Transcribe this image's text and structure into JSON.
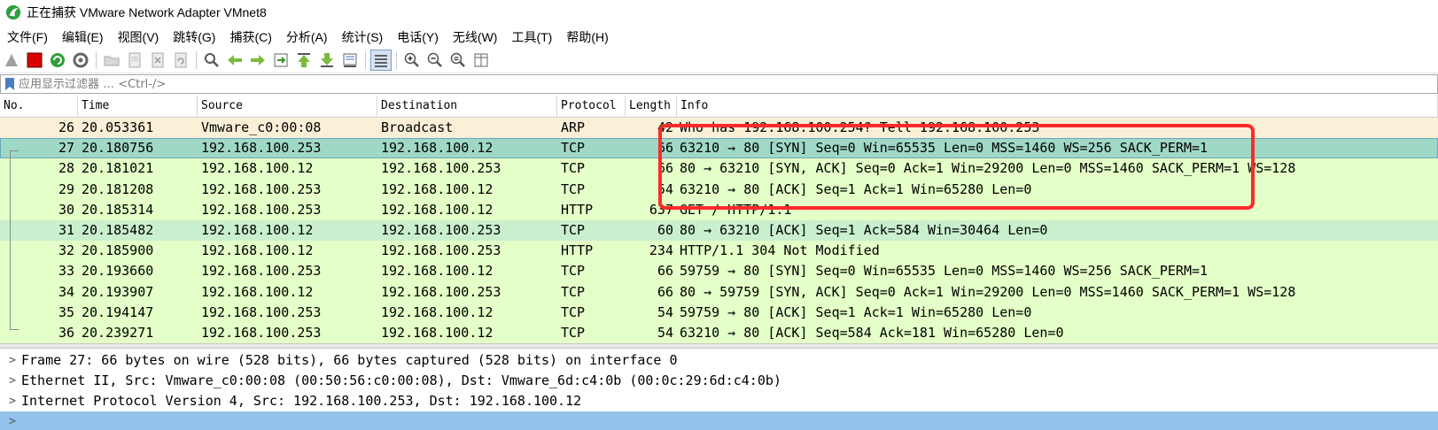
{
  "window": {
    "title": "正在捕获 VMware Network Adapter VMnet8"
  },
  "menu": [
    {
      "label": "文件(F)"
    },
    {
      "label": "编辑(E)"
    },
    {
      "label": "视图(V)"
    },
    {
      "label": "跳转(G)"
    },
    {
      "label": "捕获(C)"
    },
    {
      "label": "分析(A)"
    },
    {
      "label": "统计(S)"
    },
    {
      "label": "电话(Y)"
    },
    {
      "label": "无线(W)"
    },
    {
      "label": "工具(T)"
    },
    {
      "label": "帮助(H)"
    }
  ],
  "filter": {
    "placeholder": "应用显示过滤器 … <Ctrl-/>",
    "value": ""
  },
  "columns": {
    "no": "No.",
    "time": "Time",
    "source": "Source",
    "destination": "Destination",
    "protocol": "Protocol",
    "length": "Length",
    "info": "Info"
  },
  "rows": [
    {
      "no": "26",
      "time": "20.053361",
      "src": "Vmware_c0:00:08",
      "dst": "Broadcast",
      "proto": "ARP",
      "len": "42",
      "info": "Who has 192.168.100.254? Tell 192.168.100.253",
      "bg": "#faf0d7"
    },
    {
      "no": "27",
      "time": "20.180756",
      "src": "192.168.100.253",
      "dst": "192.168.100.12",
      "proto": "TCP",
      "len": "66",
      "info": "63210 → 80 [SYN] Seq=0 Win=65535 Len=0 MSS=1460 WS=256 SACK_PERM=1",
      "bg": "#a0d8c8",
      "selected": true
    },
    {
      "no": "28",
      "time": "20.181021",
      "src": "192.168.100.12",
      "dst": "192.168.100.253",
      "proto": "TCP",
      "len": "66",
      "info": "80 → 63210 [SYN, ACK] Seq=0 Ack=1 Win=29200 Len=0 MSS=1460 SACK_PERM=1 WS=128",
      "bg": "#e4ffc7"
    },
    {
      "no": "29",
      "time": "20.181208",
      "src": "192.168.100.253",
      "dst": "192.168.100.12",
      "proto": "TCP",
      "len": "54",
      "info": "63210 → 80 [ACK] Seq=1 Ack=1 Win=65280 Len=0",
      "bg": "#e4ffc7"
    },
    {
      "no": "30",
      "time": "20.185314",
      "src": "192.168.100.253",
      "dst": "192.168.100.12",
      "proto": "HTTP",
      "len": "637",
      "info": "GET / HTTP/1.1",
      "bg": "#e4ffc7"
    },
    {
      "no": "31",
      "time": "20.185482",
      "src": "192.168.100.12",
      "dst": "192.168.100.253",
      "proto": "TCP",
      "len": "60",
      "info": "80 → 63210 [ACK] Seq=1 Ack=584 Win=30464 Len=0",
      "bg": "#c9efcf"
    },
    {
      "no": "32",
      "time": "20.185900",
      "src": "192.168.100.12",
      "dst": "192.168.100.253",
      "proto": "HTTP",
      "len": "234",
      "info": "HTTP/1.1 304 Not Modified",
      "bg": "#e4ffc7"
    },
    {
      "no": "33",
      "time": "20.193660",
      "src": "192.168.100.253",
      "dst": "192.168.100.12",
      "proto": "TCP",
      "len": "66",
      "info": "59759 → 80 [SYN] Seq=0 Win=65535 Len=0 MSS=1460 WS=256 SACK_PERM=1",
      "bg": "#e4ffc7"
    },
    {
      "no": "34",
      "time": "20.193907",
      "src": "192.168.100.12",
      "dst": "192.168.100.253",
      "proto": "TCP",
      "len": "66",
      "info": "80 → 59759 [SYN, ACK] Seq=0 Ack=1 Win=29200 Len=0 MSS=1460 SACK_PERM=1 WS=128",
      "bg": "#e4ffc7"
    },
    {
      "no": "35",
      "time": "20.194147",
      "src": "192.168.100.253",
      "dst": "192.168.100.12",
      "proto": "TCP",
      "len": "54",
      "info": "59759 → 80 [ACK] Seq=1 Ack=1 Win=65280 Len=0",
      "bg": "#e4ffc7"
    },
    {
      "no": "36",
      "time": "20.239271",
      "src": "192.168.100.253",
      "dst": "192.168.100.12",
      "proto": "TCP",
      "len": "54",
      "info": "63210 → 80 [ACK] Seq=584 Ack=181 Win=65280 Len=0",
      "bg": "#e4ffc7"
    }
  ],
  "details": [
    {
      "text": "Frame 27: 66 bytes on wire (528 bits), 66 bytes captured (528 bits) on interface 0"
    },
    {
      "text": "Ethernet II, Src: Vmware_c0:00:08 (00:50:56:c0:00:08), Dst: Vmware_6d:c4:0b (00:0c:29:6d:c4:0b)"
    },
    {
      "text": "Internet Protocol Version 4, Src: 192.168.100.253, Dst: 192.168.100.12"
    },
    {
      "text": "",
      "selected": true
    }
  ],
  "colors": {
    "annotation": "#ff2a2a",
    "selected_detail": "#94c2ec",
    "tcp_bg": "#e4ffc7",
    "arp_bg": "#faf0d7"
  }
}
